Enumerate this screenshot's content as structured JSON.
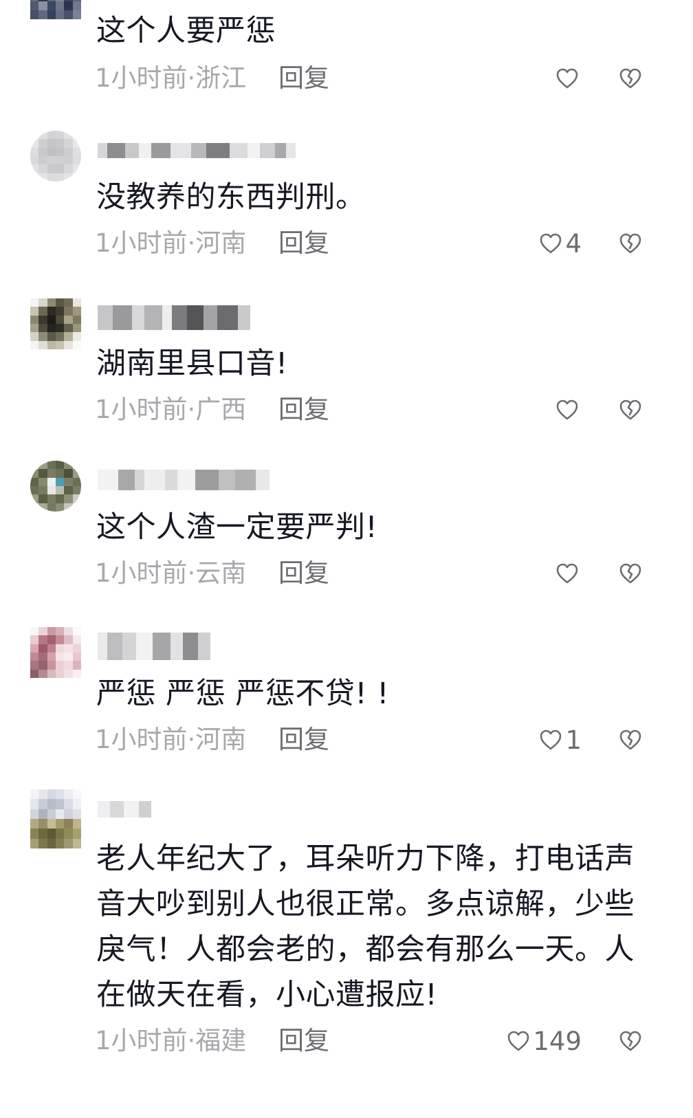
{
  "reply_label": "回复",
  "comments": [
    {
      "text": "这个人要严惩",
      "meta": "1小时前·浙江",
      "likes": ""
    },
    {
      "text": "没教养的东西判刑。",
      "meta": "1小时前·河南",
      "likes": "4"
    },
    {
      "text": "湖南里县口音!",
      "meta": "1小时前·广西",
      "likes": ""
    },
    {
      "text": "这个人渣一定要严判!",
      "meta": "1小时前·云南",
      "likes": ""
    },
    {
      "text": "严惩 严惩 严惩不贷! !",
      "meta": "1小时前·河南",
      "likes": "1"
    },
    {
      "text": "老人年纪大了，耳朵听力下降，打电话声音大吵到别人也很正常。多点谅解，少些戾气！人都会老的，都会有那么一天。人在做天在看，小心遭报应!",
      "meta": "1小时前·福建",
      "likes": "149"
    }
  ],
  "icons": {
    "like": "heart-outline-icon",
    "dislike": "broken-heart-icon"
  },
  "colors": {
    "text": "#161823",
    "meta": "#a7a8ac",
    "action": "#6b6d72"
  }
}
